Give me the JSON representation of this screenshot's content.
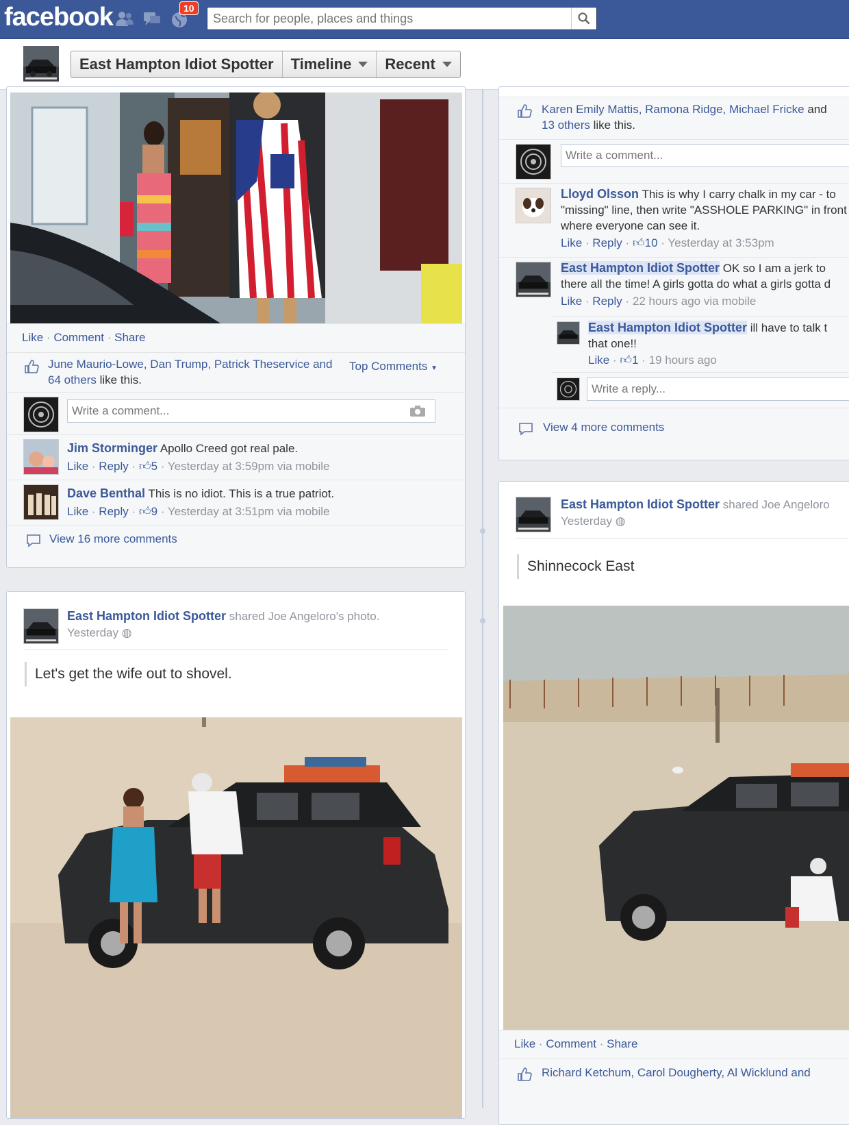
{
  "topbar": {
    "logo": "facebook",
    "notification_count": "10",
    "search_placeholder": "Search for people, places and things"
  },
  "page_header": {
    "page_name": "East Hampton Idiot Spotter",
    "timeline_label": "Timeline",
    "recent_label": "Recent"
  },
  "post1": {
    "actions": {
      "like": "Like",
      "comment": "Comment",
      "share": "Share"
    },
    "likes_text": "June Maurio-Lowe, Dan Trump, Patrick Theservice and",
    "likes_text2": "64 others",
    "likes_suffix": "like this.",
    "top_comments": "Top Comments",
    "comment_placeholder": "Write a comment...",
    "comments": [
      {
        "name": "Jim Storminger",
        "text": "Apollo Creed got real pale.",
        "like": "Like",
        "reply": "Reply",
        "likes": "5",
        "time": "Yesterday at 3:59pm via mobile"
      },
      {
        "name": "Dave Benthal",
        "text": "This is no idiot. This is a true patriot.",
        "like": "Like",
        "reply": "Reply",
        "likes": "9",
        "time": "Yesterday at 3:51pm via mobile"
      }
    ],
    "view_more": "View 16 more comments"
  },
  "post2": {
    "author": "East Hampton Idiot Spotter",
    "shared_text": "shared Joe Angeloro's photo.",
    "time": "Yesterday",
    "caption": "Let's get the wife out to shovel."
  },
  "post3": {
    "likes_names": "Karen Emily Mattis, Ramona Ridge, Michael Fricke",
    "likes_and": "and",
    "likes_others": "13 others",
    "likes_suffix": "like this.",
    "comment_placeholder": "Write a comment...",
    "comments": [
      {
        "name": "Lloyd Olsson",
        "line1": "This is why I carry chalk in my car - to",
        "line2": "\"missing\" line, then write \"ASSHOLE PARKING\" in front",
        "line3": "where everyone can see it.",
        "like": "Like",
        "reply": "Reply",
        "likes": "10",
        "time": "Yesterday at 3:53pm"
      },
      {
        "name": "East Hampton Idiot Spotter",
        "line1": "OK so I am a jerk to",
        "line2": "there all the time! A girls gotta do what a girls gotta d",
        "like": "Like",
        "reply": "Reply",
        "time": "22 hours ago via mobile"
      }
    ],
    "reply": {
      "name": "East Hampton Idiot Spotter",
      "line1": "ill have to talk t",
      "line2": "that one!!",
      "like": "Like",
      "likes": "1",
      "time": "19 hours ago"
    },
    "reply_placeholder": "Write a reply...",
    "view_more": "View 4 more comments"
  },
  "post4": {
    "author": "East Hampton Idiot Spotter",
    "shared_text": "shared Joe Angeloro",
    "time": "Yesterday",
    "caption": "Shinnecock East",
    "actions": {
      "like": "Like",
      "comment": "Comment",
      "share": "Share"
    },
    "likes_text": "Richard Ketchum, Carol Dougherty, Al Wicklund and"
  },
  "colors": {
    "brand": "#3b5998",
    "background": "#e9ebee",
    "badge": "#f03d25"
  }
}
